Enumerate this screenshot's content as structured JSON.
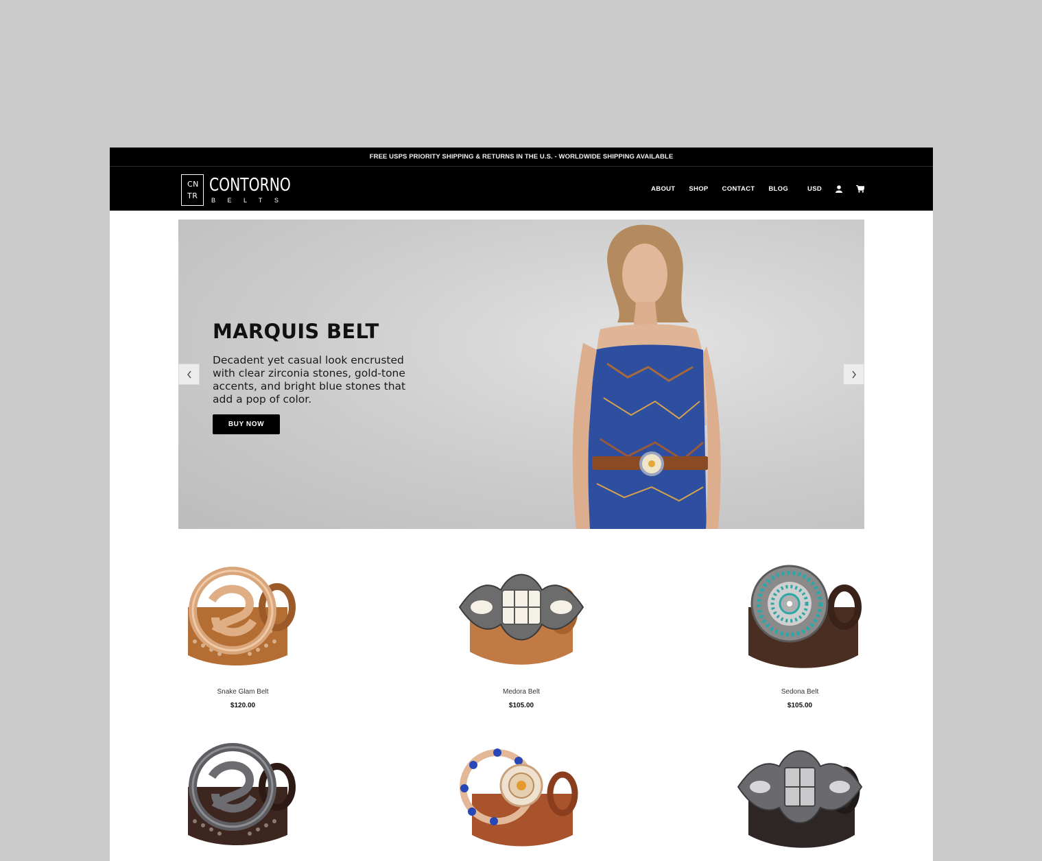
{
  "announcement": "FREE USPS PRIORITY SHIPPING & RETURNS IN THE U.S. - WORLDWIDE SHIPPING AVAILABLE",
  "logo": {
    "monogram_top": "CN",
    "monogram_bottom": "TR",
    "name": "CONTORNO",
    "tagline": "BELTS"
  },
  "nav": {
    "items": [
      "ABOUT",
      "SHOP",
      "CONTACT",
      "BLOG"
    ],
    "currency": "USD",
    "account_icon": "user-icon",
    "cart_icon": "cart-icon"
  },
  "hero": {
    "title": "MARQUIS BELT",
    "description": "Decadent yet casual look encrusted with clear zirconia stones, gold-tone accents, and bright blue stones that add a pop of color.",
    "button_label": "BUY NOW",
    "prev_icon": "chevron-left-icon",
    "next_icon": "chevron-right-icon"
  },
  "products": [
    {
      "name": "Snake Glam Belt",
      "price": "$120.00"
    },
    {
      "name": "Medora Belt",
      "price": "$105.00"
    },
    {
      "name": "Sedona Belt",
      "price": "$105.00"
    },
    {
      "name": "",
      "price": ""
    },
    {
      "name": "",
      "price": ""
    },
    {
      "name": "",
      "price": ""
    }
  ],
  "colors": {
    "background": "#cbcbcb",
    "header": "#000000",
    "accent": "#000000"
  }
}
